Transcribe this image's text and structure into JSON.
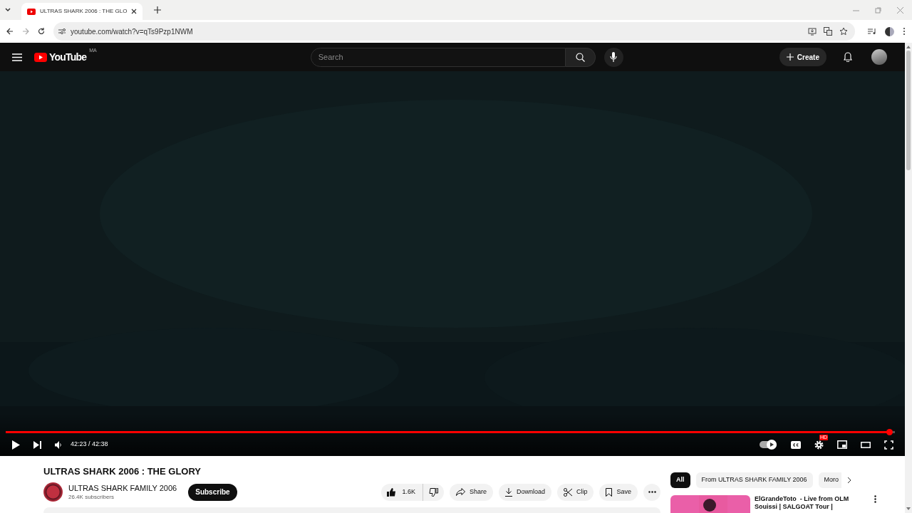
{
  "browser": {
    "tab_title": "ULTRAS SHARK 2006 : THE GLO",
    "url": "youtube.com/watch?v=qTs9Pzp1NWM"
  },
  "header": {
    "logo": "YouTube",
    "country": "MA",
    "search": {
      "placeholder": "Search"
    },
    "create": "Create"
  },
  "player": {
    "level": 0.994,
    "time": "42:23 / 42:38",
    "autoplay": true,
    "hd_badge": "HD"
  },
  "video": {
    "title": "ULTRAS SHARK 2006 : THE GLORY",
    "channel": "ULTRAS SHARK FAMILY 2006",
    "subscribers": "26.4K subscribers",
    "subscribe": "Subscribe",
    "actions": [
      {
        "kind": "like",
        "label": "1.6K"
      },
      {
        "kind": "share",
        "label": "Share"
      },
      {
        "kind": "download",
        "label": "Download"
      },
      {
        "kind": "clip",
        "label": "Clip"
      },
      {
        "kind": "save",
        "label": "Save"
      }
    ]
  },
  "chips": [
    {
      "label": "All",
      "selected": true
    },
    {
      "label": "From ULTRAS SHARK FAMILY 2006",
      "selected": false
    },
    {
      "label": "Moro",
      "selected": false
    }
  ],
  "recommended": [
    {
      "title": "ElGrandeToto  - Live from OLM Souissi | SALGOAT Tour |"
    }
  ]
}
